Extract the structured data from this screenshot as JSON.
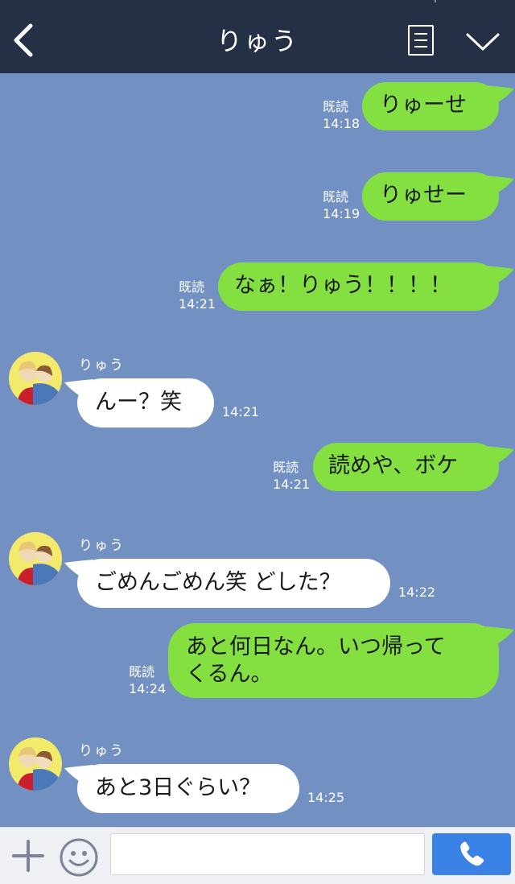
{
  "header": {
    "title": "りゅう"
  },
  "contact": {
    "name": "りゅう"
  },
  "messages": [
    {
      "side": "me",
      "text": "りゅーせ",
      "status": "既読",
      "time": "14:18"
    },
    {
      "side": "me",
      "text": "りゅせー",
      "status": "既読",
      "time": "14:19"
    },
    {
      "side": "me",
      "text": "なぁ！りゅう！！！！",
      "status": "既読",
      "time": "14:21"
    },
    {
      "side": "them",
      "sender": "りゅう",
      "text": "んー？笑",
      "time": "14:21"
    },
    {
      "side": "me",
      "text": "読めや、ボケ",
      "status": "既読",
      "time": "14:21"
    },
    {
      "side": "them",
      "sender": "りゅう",
      "text": "ごめんごめん笑 どした？",
      "time": "14:22"
    },
    {
      "side": "me",
      "text_line1": "あと何日なん。いつ帰って",
      "text_line2": "くるん。",
      "status": "既読",
      "time": "14:24"
    },
    {
      "side": "them",
      "sender": "りゅう",
      "text": "あと3日ぐらい？",
      "time": "14:25"
    }
  ],
  "composer": {
    "text_value": ""
  },
  "colors": {
    "header_bg": "#252f45",
    "chat_bg": "#7291c2",
    "my_bubble": "#84e041",
    "their_bubble": "#ffffff",
    "call_button": "#3b82e6"
  },
  "icons": [
    "back-arrow-icon",
    "menu-list-icon",
    "chevron-down-icon",
    "plus-icon",
    "smiley-icon",
    "phone-icon",
    "contact-avatar"
  ]
}
